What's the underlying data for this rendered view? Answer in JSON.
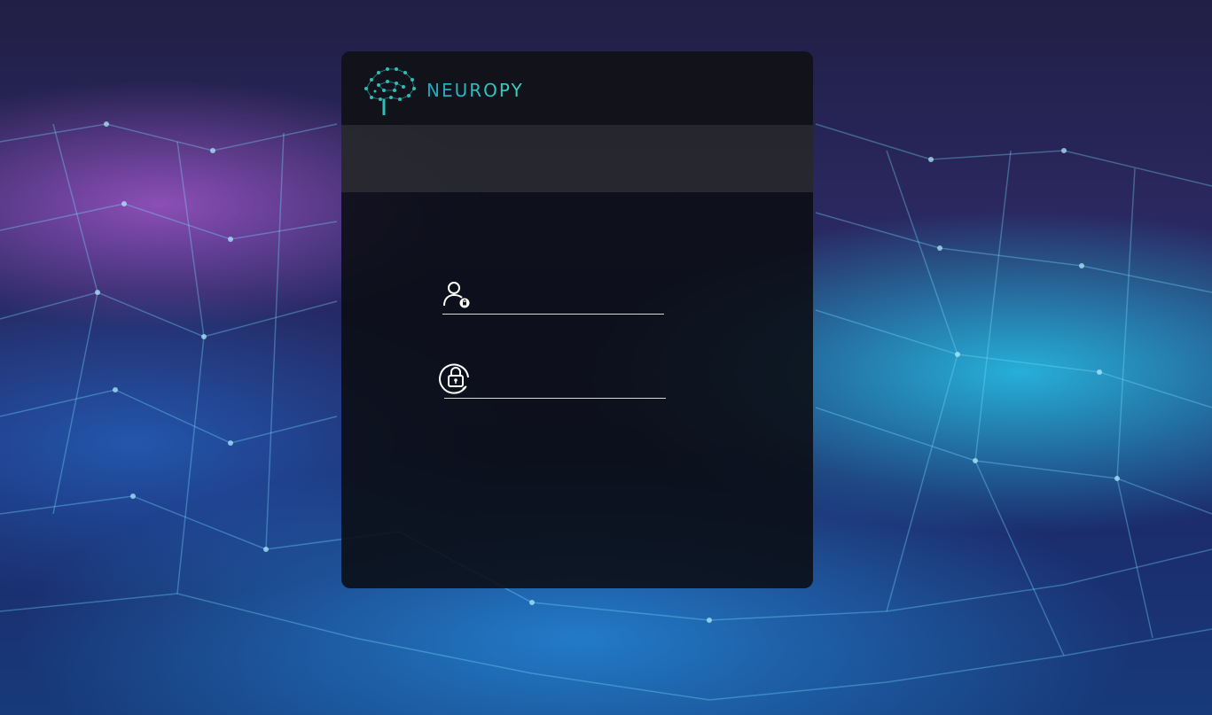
{
  "brand": {
    "name": "NEUROPY",
    "accent_color": "#2fc6c4"
  },
  "login": {
    "username_icon": "user-lock-icon",
    "username_value": "",
    "username_placeholder": "",
    "password_icon": "padlock-circle-icon",
    "password_value": "",
    "password_placeholder": ""
  }
}
